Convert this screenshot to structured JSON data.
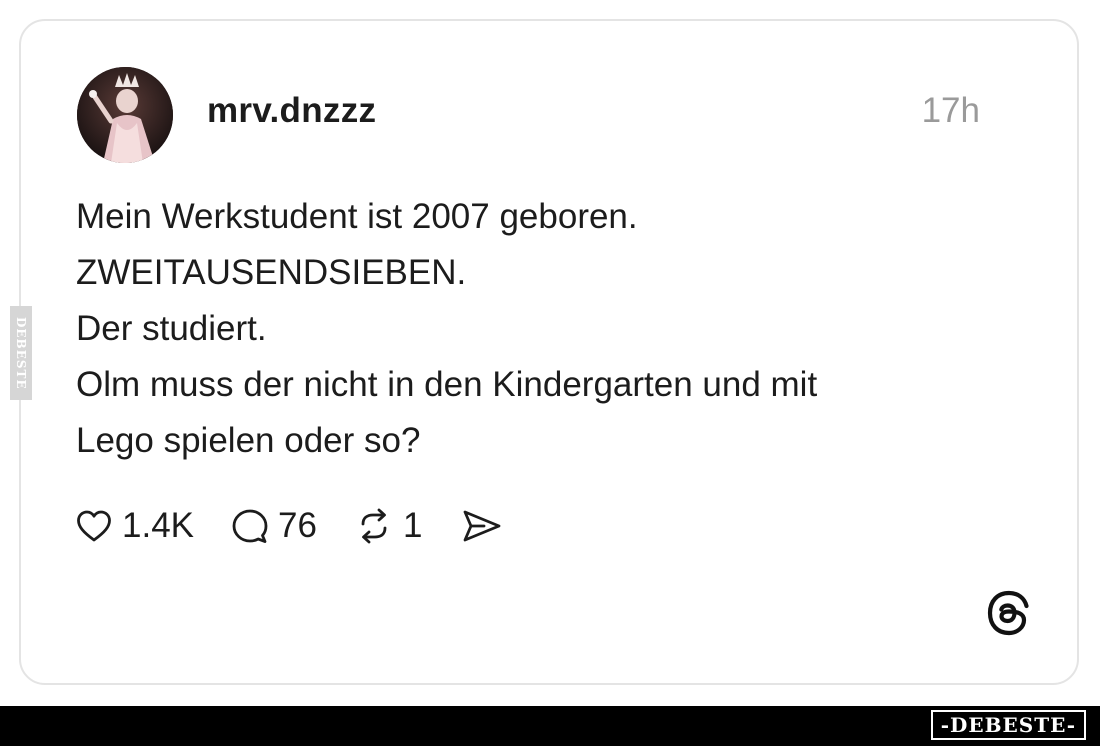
{
  "post": {
    "username": "mrv.dnzzz",
    "time": "17h",
    "lines": [
      "Mein Werkstudent ist 2007 geboren.",
      "ZWEITAUSENDSIEBEN.",
      "Der studiert.",
      "Olm muss der nicht in den Kindergarten und mit",
      "Lego spielen oder so?"
    ],
    "likes": "1.4K",
    "comments": "76",
    "reposts": "1"
  },
  "icons": {
    "like": "heart-icon",
    "comment": "comment-bubble-icon",
    "repost": "repost-icon",
    "share": "share-icon",
    "brand": "threads-logo-icon"
  },
  "watermarks": {
    "side": "DEBESTE",
    "footer": "-DEBESTE-"
  },
  "colors": {
    "text": "#1c1c1c",
    "muted": "#9a9a9a",
    "border": "#e4e4e4",
    "footer": "#000000"
  }
}
